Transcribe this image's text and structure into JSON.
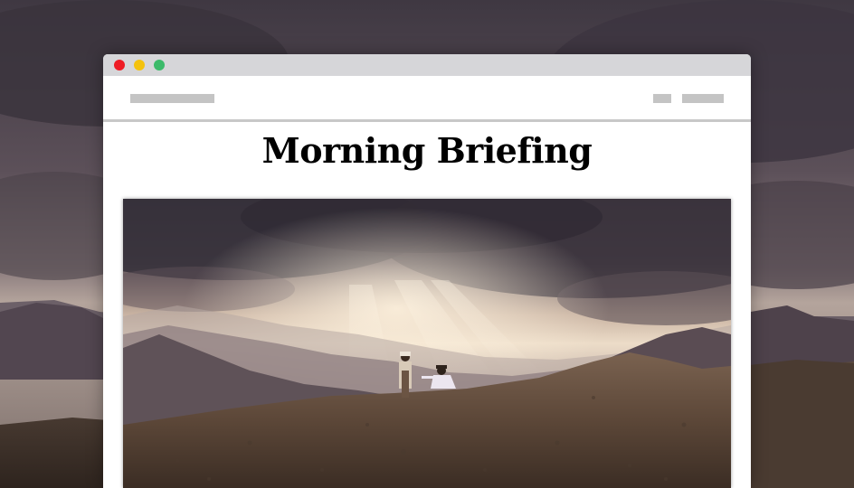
{
  "browser": {
    "window_controls": [
      "close",
      "minimize",
      "maximize"
    ]
  },
  "article": {
    "headline": "Morning Briefing"
  },
  "colors": {
    "close": "#ee1c25",
    "minimize": "#f4c20d",
    "maximize": "#3cba6a",
    "chrome": "#d6d6d9",
    "placeholder": "#c4c4c4"
  },
  "icons": [
    "close-icon",
    "minimize-icon",
    "maximize-icon"
  ]
}
